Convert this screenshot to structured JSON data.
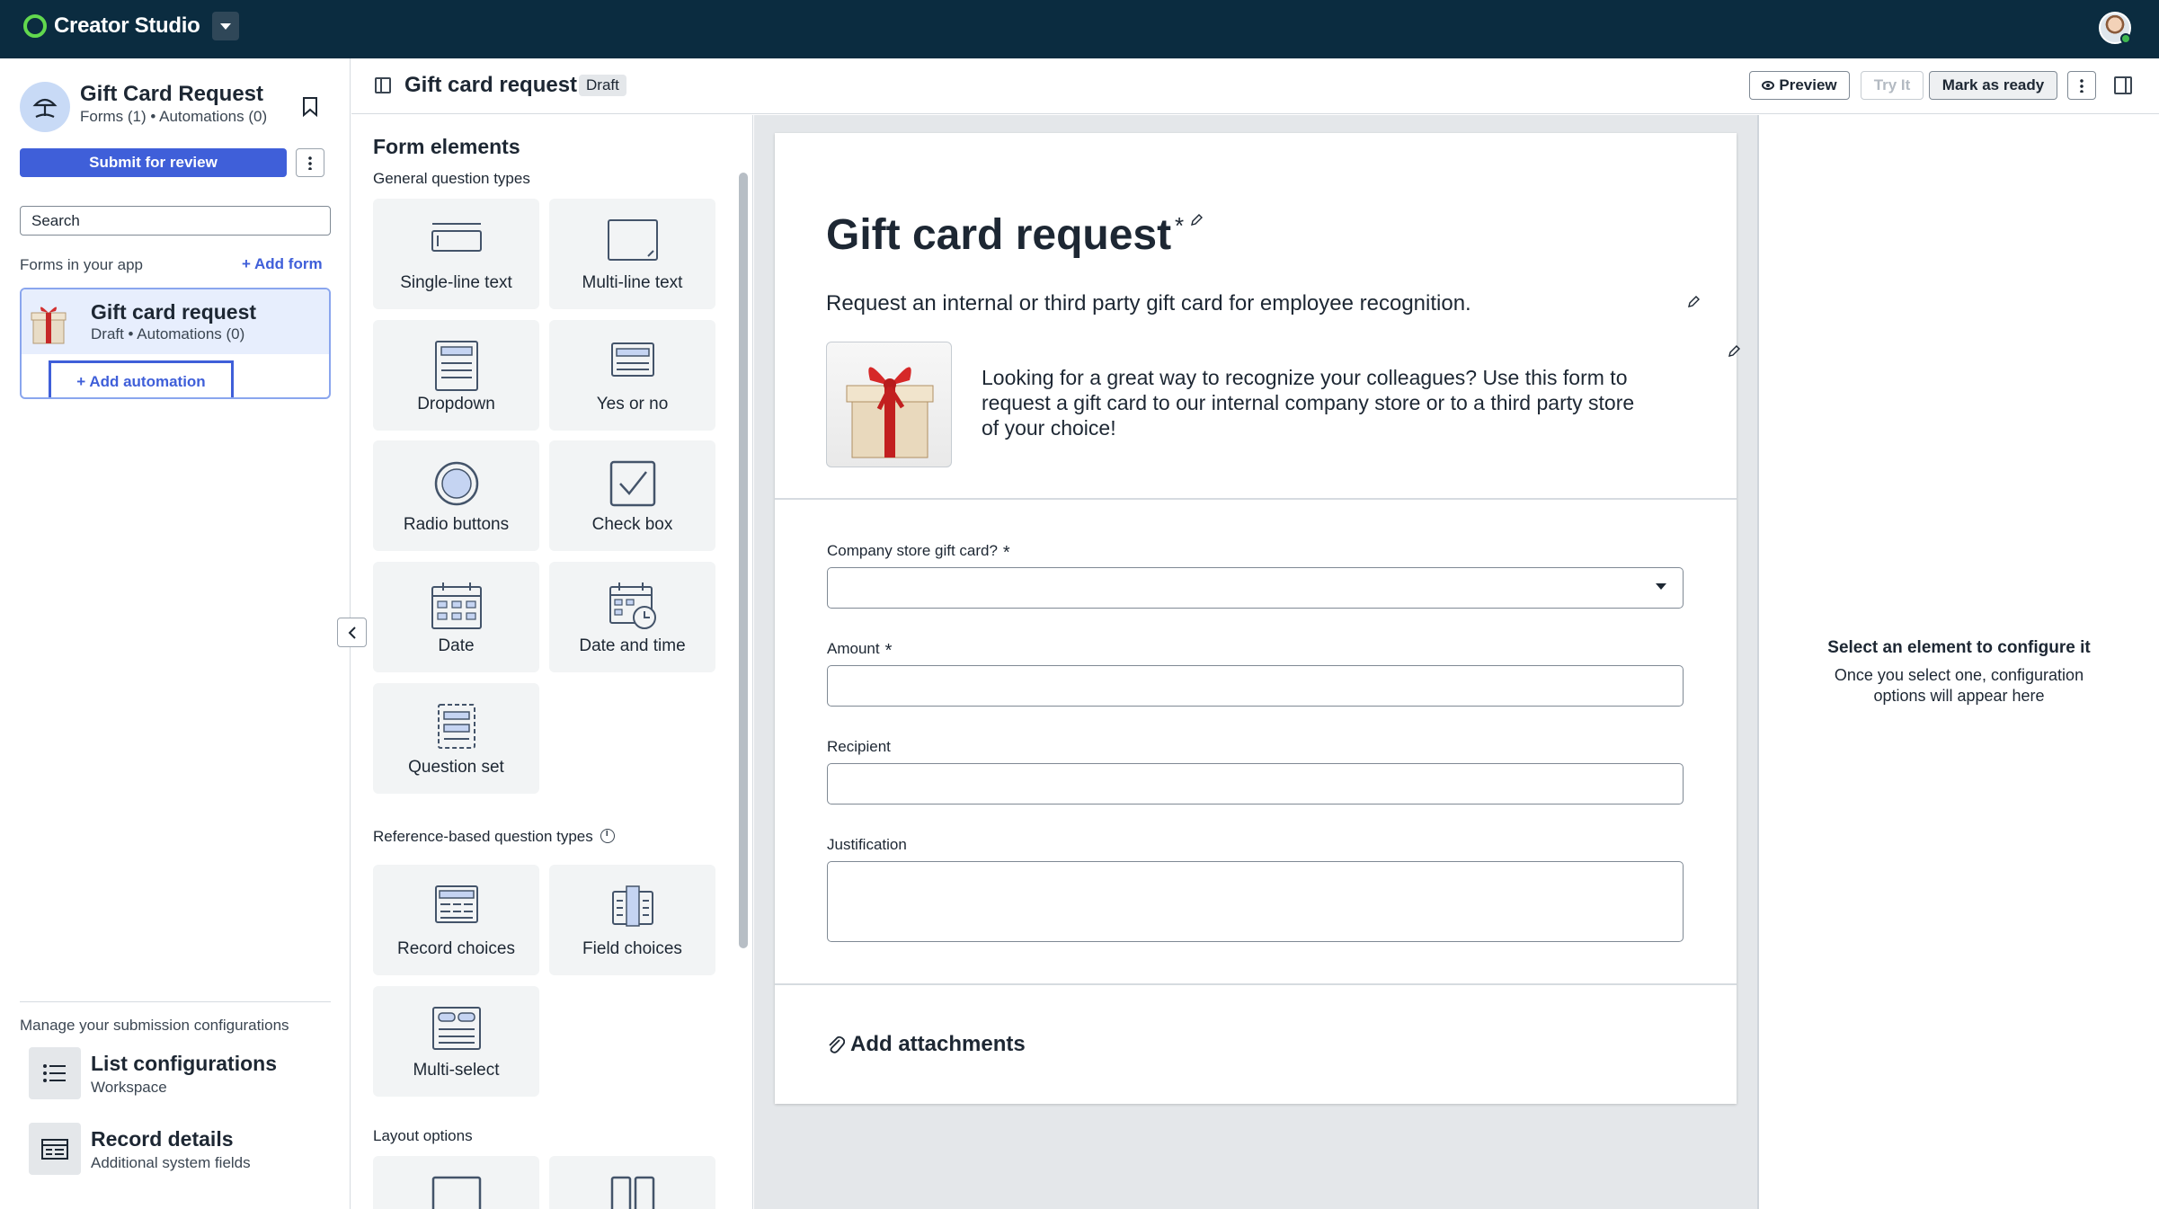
{
  "topbar": {
    "app_name": "Creator Studio"
  },
  "sidebar": {
    "app_title": "Gift Card Request",
    "app_subtitle": "Forms (1) • Automations (0)",
    "submit_label": "Submit for review",
    "search_placeholder": "Search",
    "forms_label": "Forms in your app",
    "add_form_label": "+ Add form",
    "form_card": {
      "title": "Gift card request",
      "subtitle": "Draft • Automations (0)",
      "add_automation_label": "+ Add automation"
    },
    "manage_label": "Manage your submission configurations",
    "configs": [
      {
        "title": "List configurations",
        "subtitle": "Workspace",
        "icon": "list-icon"
      },
      {
        "title": "Record details",
        "subtitle": "Additional system fields",
        "icon": "record-details-icon"
      }
    ]
  },
  "header": {
    "title": "Gift card request",
    "status": "Draft",
    "preview_label": "Preview",
    "tryit_label": "Try It",
    "ready_label": "Mark as ready"
  },
  "palette": {
    "title": "Form elements",
    "general_label": "General question types",
    "general": [
      "Single-line text",
      "Multi-line text",
      "Dropdown",
      "Yes or no",
      "Radio buttons",
      "Check box",
      "Date",
      "Date and time",
      "Question set"
    ],
    "reference_label": "Reference-based question types",
    "reference": [
      "Record choices",
      "Field choices",
      "Multi-select"
    ],
    "layout_label": "Layout options"
  },
  "form": {
    "title": "Gift card request",
    "required_mark": "*",
    "description": "Request an internal or third party gift card for employee recognition.",
    "intro": "Looking for a great way to recognize your colleagues? Use this form to request a gift card to our internal company store or to a third party store of your choice!",
    "fields": [
      {
        "label": "Company store gift card?",
        "required": "*",
        "type": "select",
        "value": ""
      },
      {
        "label": "Amount",
        "required": "*",
        "type": "text",
        "value": ""
      },
      {
        "label": "Recipient",
        "required": "",
        "type": "text",
        "value": ""
      },
      {
        "label": "Justification",
        "required": "",
        "type": "textarea",
        "value": ""
      }
    ],
    "attachments_label": "Add attachments"
  },
  "config_panel": {
    "title": "Select an element to configure it",
    "text": "Once you select one, configuration options will appear here"
  },
  "colors": {
    "topbar": "#0b2c40",
    "brand_green": "#62d84e",
    "accent_blue": "#3f5fd9"
  }
}
